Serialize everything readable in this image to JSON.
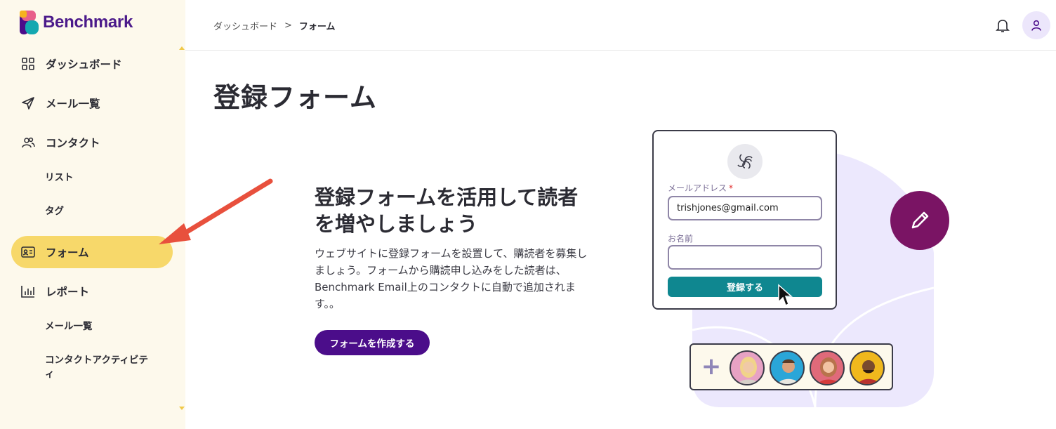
{
  "brand": {
    "name": "Benchmark"
  },
  "sidebar": {
    "items": [
      {
        "label": "ダッシュボード",
        "icon": "grid-icon"
      },
      {
        "label": "メール一覧",
        "icon": "send-icon"
      },
      {
        "label": "コンタクト",
        "icon": "users-icon"
      },
      {
        "label": "リスト"
      },
      {
        "label": "タグ"
      },
      {
        "label": "フォーム",
        "icon": "id-card-icon",
        "active": true
      },
      {
        "label": "レポート",
        "icon": "bar-chart-icon"
      },
      {
        "label": "メール一覧"
      },
      {
        "label": "コンタクトアクティビテ"
      },
      {
        "label": "ィ"
      }
    ]
  },
  "header": {
    "breadcrumb": [
      "ダッシュボード",
      "フォーム"
    ],
    "separator": ">"
  },
  "page": {
    "title": "登録フォーム"
  },
  "promo": {
    "heading_line1": "登録フォームを活用して読者",
    "heading_line2": "を増やしましょう",
    "body_line1": "ウェブサイトに登録フォームを設置して、購読者を募集し",
    "body_line2": "ましょう。フォームから購読申し込みをした読者は、",
    "body_line3": "Benchmark Email上のコンタクトに自動で追加されま",
    "body_line4": "す。。",
    "cta_label": "フォームを作成する"
  },
  "illustration": {
    "email_label": "メールアドレス",
    "required_mark": "*",
    "email_value": "trishjones@gmail.com",
    "name_label": "お名前",
    "name_value": "",
    "submit_label": "登録する",
    "plus": "+"
  },
  "colors": {
    "sidebar_bg": "#fdf9ec",
    "active_nav": "#f7d86a",
    "brand_purple": "#4b0d8a",
    "teal": "#0f8790",
    "plum": "#7a1464",
    "lavender": "#ece6fb",
    "arrow": "#e8503d"
  }
}
